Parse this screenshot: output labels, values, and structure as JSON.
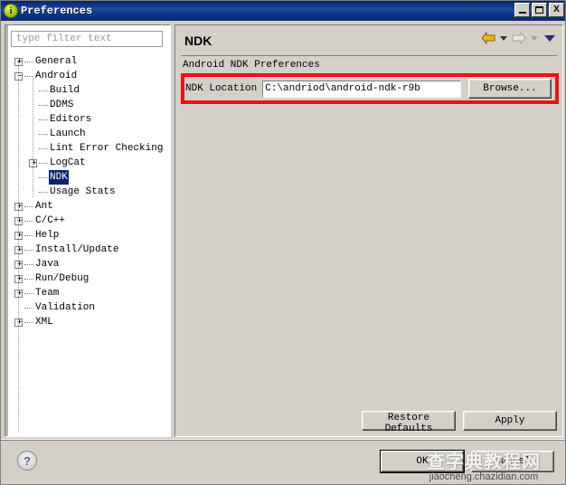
{
  "window": {
    "title": "Preferences",
    "icon": "info-circle-icon",
    "minimize_label": "_",
    "maximize_label": "",
    "close_label": "X"
  },
  "filter": {
    "placeholder": "type filter text",
    "value": ""
  },
  "tree": {
    "items": [
      {
        "label": "General",
        "depth": 0,
        "expander": "plus",
        "selected": false
      },
      {
        "label": "Android",
        "depth": 0,
        "expander": "minus",
        "selected": false
      },
      {
        "label": "Build",
        "depth": 1,
        "expander": "none",
        "selected": false
      },
      {
        "label": "DDMS",
        "depth": 1,
        "expander": "none",
        "selected": false
      },
      {
        "label": "Editors",
        "depth": 1,
        "expander": "none",
        "selected": false
      },
      {
        "label": "Launch",
        "depth": 1,
        "expander": "none",
        "selected": false
      },
      {
        "label": "Lint Error Checking",
        "depth": 1,
        "expander": "none",
        "selected": false
      },
      {
        "label": "LogCat",
        "depth": 1,
        "expander": "plus",
        "selected": false
      },
      {
        "label": "NDK",
        "depth": 1,
        "expander": "none",
        "selected": true
      },
      {
        "label": "Usage Stats",
        "depth": 1,
        "expander": "none",
        "selected": false
      },
      {
        "label": "Ant",
        "depth": 0,
        "expander": "plus",
        "selected": false
      },
      {
        "label": "C/C++",
        "depth": 0,
        "expander": "plus",
        "selected": false
      },
      {
        "label": "Help",
        "depth": 0,
        "expander": "plus",
        "selected": false
      },
      {
        "label": "Install/Update",
        "depth": 0,
        "expander": "plus",
        "selected": false
      },
      {
        "label": "Java",
        "depth": 0,
        "expander": "plus",
        "selected": false
      },
      {
        "label": "Run/Debug",
        "depth": 0,
        "expander": "plus",
        "selected": false
      },
      {
        "label": "Team",
        "depth": 0,
        "expander": "plus",
        "selected": false
      },
      {
        "label": "Validation",
        "depth": 0,
        "expander": "none",
        "selected": false
      },
      {
        "label": "XML",
        "depth": 0,
        "expander": "plus",
        "selected": false
      }
    ]
  },
  "page": {
    "title": "NDK",
    "nav": {
      "back_icon": "back-arrow-icon",
      "back_menu_icon": "chevron-down-icon",
      "forward_icon": "forward-arrow-icon",
      "forward_menu_icon": "chevron-down-icon",
      "overflow_icon": "chevron-down-icon"
    },
    "group_label": "Android NDK Preferences",
    "ndk_location": {
      "label": "NDK Location",
      "value": "C:\\andriod\\android-ndk-r9b",
      "placeholder": "",
      "browse_label": "Browse..."
    },
    "restore_defaults_label": "Restore Defaults",
    "apply_label": "Apply"
  },
  "footer": {
    "help_label": "?",
    "ok_label": "OK",
    "cancel_label": "Cancel"
  },
  "watermark": {
    "cn": "查字典教程网",
    "url": "jiaocheng.chazidian.com"
  },
  "colors": {
    "titlebar_start": "#0a246a",
    "titlebar_end": "#0a2a70",
    "chrome": "#d4d0c8",
    "selection": "#0a246a",
    "highlight_box": "#ee1111",
    "field_bg": "#ffffff"
  }
}
